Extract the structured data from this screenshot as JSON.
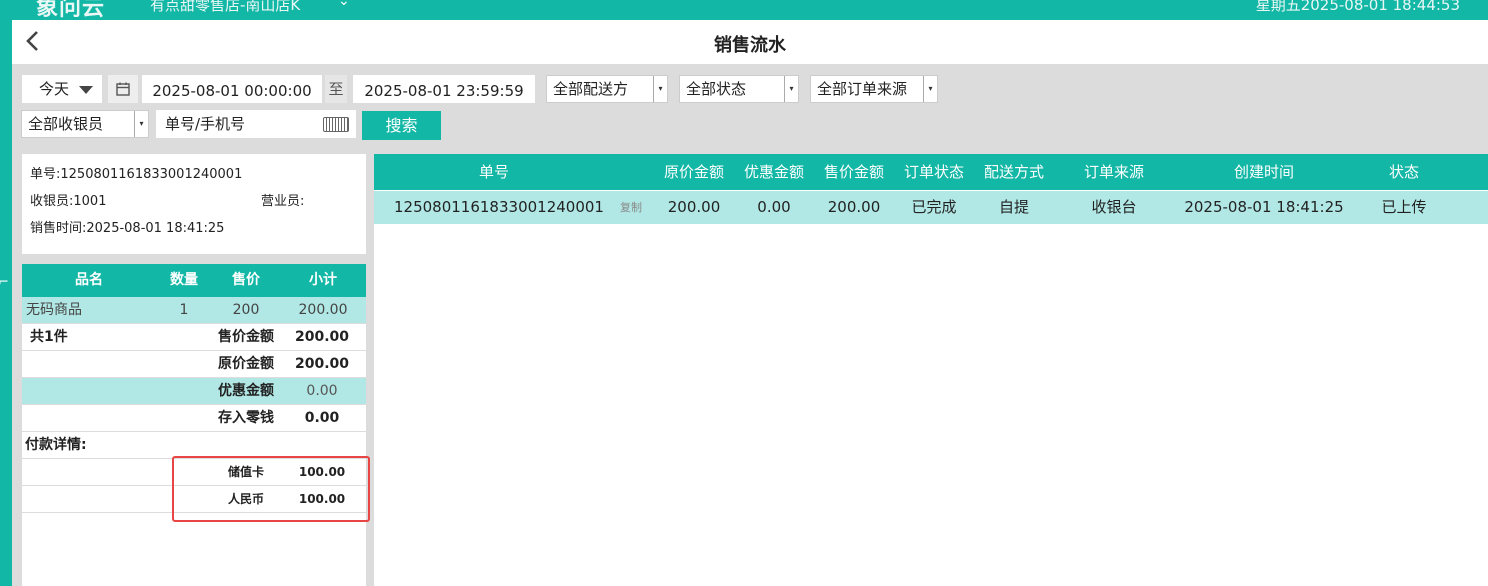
{
  "topbar": {
    "logo": "象问云",
    "store": "有点甜零售店-南山店K",
    "clock": "星期五2025-08-01 18:44:53"
  },
  "page": {
    "title": "销售流水"
  },
  "filters": {
    "date_range": "今天",
    "start": "2025-08-01 00:00:00",
    "to_label": "至",
    "end": "2025-08-01 23:59:59",
    "delivery": "全部配送方",
    "status": "全部状态",
    "source": "全部订单来源",
    "cashier": "全部收银员",
    "search_placeholder": "单号/手机号",
    "search_label": "搜索"
  },
  "receipt": {
    "order_no": "单号:1250801161833001240001",
    "cashier": "收银员:1001",
    "clerk": "营业员:",
    "sale_time": "销售时间:2025-08-01 18:41:25",
    "columns": [
      "品名",
      "数量",
      "售价",
      "小计"
    ],
    "items": [
      {
        "name": "无码商品",
        "qty": "1",
        "price": "200",
        "subtotal": "200.00"
      }
    ],
    "total_count": "共1件",
    "summary": [
      {
        "label": "售价金额",
        "value": "200.00"
      },
      {
        "label": "原价金额",
        "value": "200.00"
      },
      {
        "label": "优惠金额",
        "value": "0.00"
      },
      {
        "label": "存入零钱",
        "value": "0.00"
      }
    ],
    "payment_title": "付款详情:",
    "payments": [
      {
        "method": "储值卡",
        "amount": "100.00"
      },
      {
        "method": "人民币",
        "amount": "100.00"
      }
    ]
  },
  "orders": {
    "columns": [
      "单号",
      "原价金额",
      "优惠金额",
      "售价金额",
      "订单状态",
      "配送方式",
      "订单来源",
      "创建时间",
      "状态"
    ],
    "copy_label": "复制",
    "rows": [
      {
        "order_no": "1250801161833001240001",
        "original": "200.00",
        "discount": "0.00",
        "sale": "200.00",
        "order_status": "已完成",
        "delivery": "自提",
        "source": "收银台",
        "created": "2025-08-01 18:41:25",
        "status": "已上传"
      }
    ]
  },
  "icons": {
    "back": "chevron-left-icon",
    "calendar": "calendar-icon",
    "keyboard": "keyboard-icon"
  },
  "colors": {
    "accent": "#13b7a6",
    "row_highlight": "#b1e8e5",
    "highlight_border": "#e84545"
  }
}
